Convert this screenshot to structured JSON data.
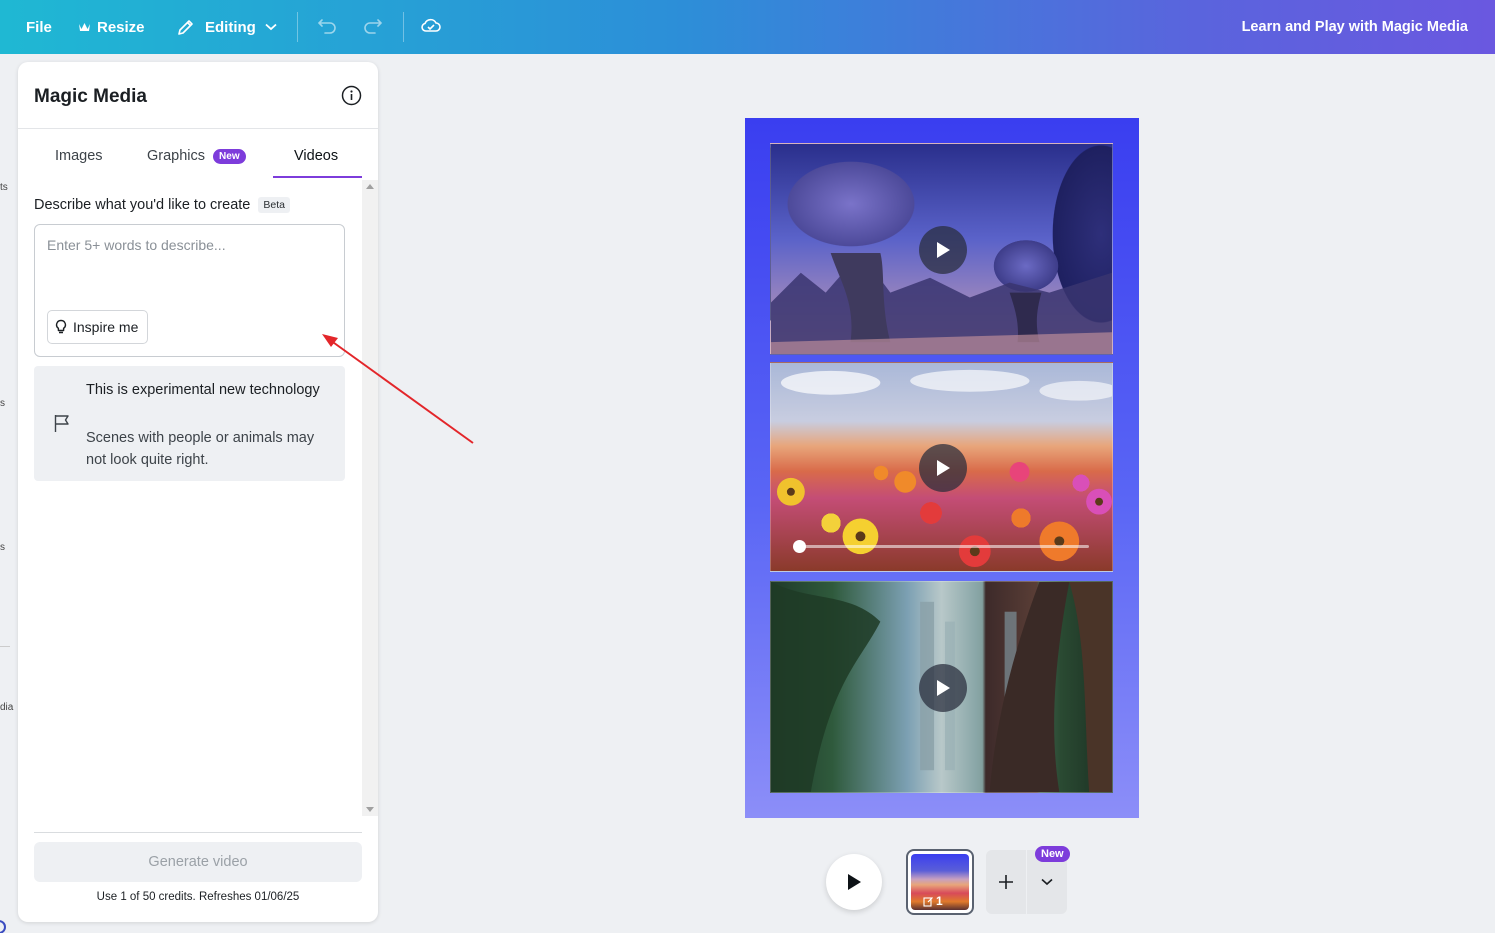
{
  "topbar": {
    "file_label": "File",
    "resize_label": "Resize",
    "editing_label": "Editing",
    "title": "Learn and Play with Magic Media",
    "icons": [
      "crown-icon",
      "pencil-icon",
      "chevron-down-icon",
      "undo-icon",
      "redo-icon",
      "cloud-check-icon"
    ]
  },
  "rail": {
    "fragments": [
      "ts",
      "s",
      "s",
      "dia"
    ]
  },
  "panel": {
    "title": "Magic Media",
    "tabs": [
      {
        "label": "Images"
      },
      {
        "label": "Graphics",
        "badge": "New"
      },
      {
        "label": "Videos",
        "active": true
      }
    ],
    "describe_label": "Describe what you'd like to create",
    "beta_label": "Beta",
    "prompt": {
      "value": "",
      "placeholder": "Enter 5+ words to describe..."
    },
    "inspire_label": "Inspire me",
    "notice": {
      "title": "This is experimental new technology",
      "text": "Scenes with people or animals may not look quite right."
    },
    "generate_label": "Generate video",
    "credits": "Use 1 of 50 credits. Refreshes 01/06/25"
  },
  "canvas": {
    "clips": [
      {
        "name": "alien-landscape-clip"
      },
      {
        "name": "flower-field-clip",
        "progress": 0.0
      },
      {
        "name": "forest-city-clip"
      }
    ]
  },
  "bottom": {
    "page_number": "1",
    "new_badge": "New"
  },
  "colors": {
    "accent": "#7d3cdb",
    "annotation": "#e3262a"
  }
}
